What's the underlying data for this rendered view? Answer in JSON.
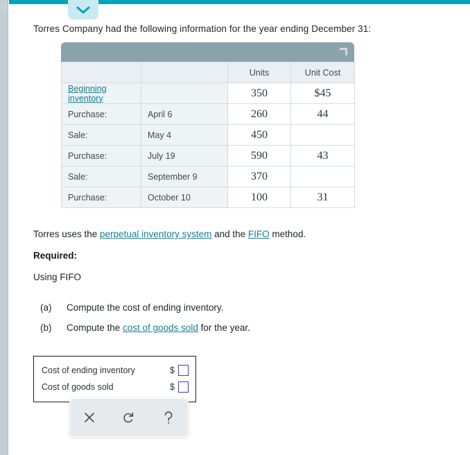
{
  "window": {
    "collapse_icon": "chevron-down-icon",
    "accent_color": "#00a5b8"
  },
  "question": {
    "intro": "Torres Company had the following information for the year ending December 31:",
    "method_sentence": {
      "before": "Torres uses the ",
      "link1": "perpetual inventory system",
      "middle": " and the ",
      "link2": "FIFO",
      "after": " method."
    },
    "required_heading": "Required:",
    "using_line": "Using FIFO",
    "requirements": [
      {
        "letter": "(a)",
        "before": "Compute the cost of ending inventory.",
        "link": "",
        "after": ""
      },
      {
        "letter": "(b)",
        "before": "Compute the ",
        "link": "cost of goods sold",
        "after": " for the year."
      }
    ]
  },
  "table": {
    "corner_handle_icon": "resize-corner-icon",
    "headers": [
      "",
      "",
      "Units",
      "Unit Cost"
    ],
    "rows": [
      {
        "desc": "Beginning inventory",
        "desc_is_link": true,
        "date": "",
        "units": "350",
        "cost": "$45"
      },
      {
        "desc": "Purchase:",
        "desc_is_link": false,
        "date": "April 6",
        "units": "260",
        "cost": "44"
      },
      {
        "desc": "Sale:",
        "desc_is_link": false,
        "date": "May 4",
        "units": "450",
        "cost": ""
      },
      {
        "desc": "Purchase:",
        "desc_is_link": false,
        "date": "July 19",
        "units": "590",
        "cost": "43"
      },
      {
        "desc": "Sale:",
        "desc_is_link": false,
        "date": "September 9",
        "units": "370",
        "cost": ""
      },
      {
        "desc": "Purchase:",
        "desc_is_link": false,
        "date": "October 10",
        "units": "100",
        "cost": "31"
      }
    ]
  },
  "answer_box": {
    "rows": [
      {
        "label": "Cost of ending inventory",
        "currency": "$",
        "value": ""
      },
      {
        "label": "Cost of goods sold",
        "currency": "$",
        "value": ""
      }
    ]
  },
  "palette": {
    "buttons": [
      {
        "name": "clear-button",
        "icon": "close-x-icon"
      },
      {
        "name": "undo-button",
        "icon": "undo-arrow-icon"
      },
      {
        "name": "help-button",
        "icon": "question-mark-icon"
      }
    ]
  }
}
